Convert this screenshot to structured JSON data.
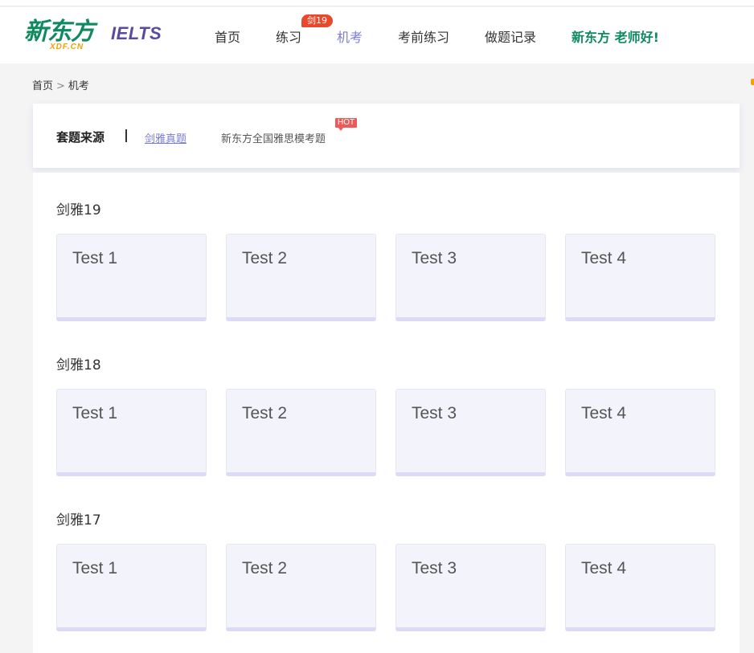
{
  "header": {
    "logo_text": "新东方",
    "logo_sub": "XDF.CN",
    "product": "IELTS",
    "nav": [
      {
        "label": "首页"
      },
      {
        "label": "练习",
        "badge": "剑19"
      },
      {
        "label": "机考",
        "active": true
      },
      {
        "label": "考前练习"
      },
      {
        "label": "做题记录"
      }
    ],
    "greeting": "新东方 老师好!"
  },
  "breadcrumb": {
    "home": "首页",
    "separator": ">",
    "current": "机考"
  },
  "source": {
    "title": "套题来源",
    "options": [
      {
        "label": "剑雅真题",
        "active": true
      },
      {
        "label": "新东方全国雅思模考题",
        "badge": "HOT"
      }
    ]
  },
  "sections": [
    {
      "title": "剑雅19",
      "tests": [
        "Test 1",
        "Test 2",
        "Test 3",
        "Test 4"
      ]
    },
    {
      "title": "剑雅18",
      "tests": [
        "Test 1",
        "Test 2",
        "Test 3",
        "Test 4"
      ]
    },
    {
      "title": "剑雅17",
      "tests": [
        "Test 1",
        "Test 2",
        "Test 3",
        "Test 4"
      ]
    }
  ],
  "colors": {
    "brand_green": "#0f8a5f",
    "accent_purple": "#7b7bd6",
    "badge_red": "#e8492c"
  }
}
